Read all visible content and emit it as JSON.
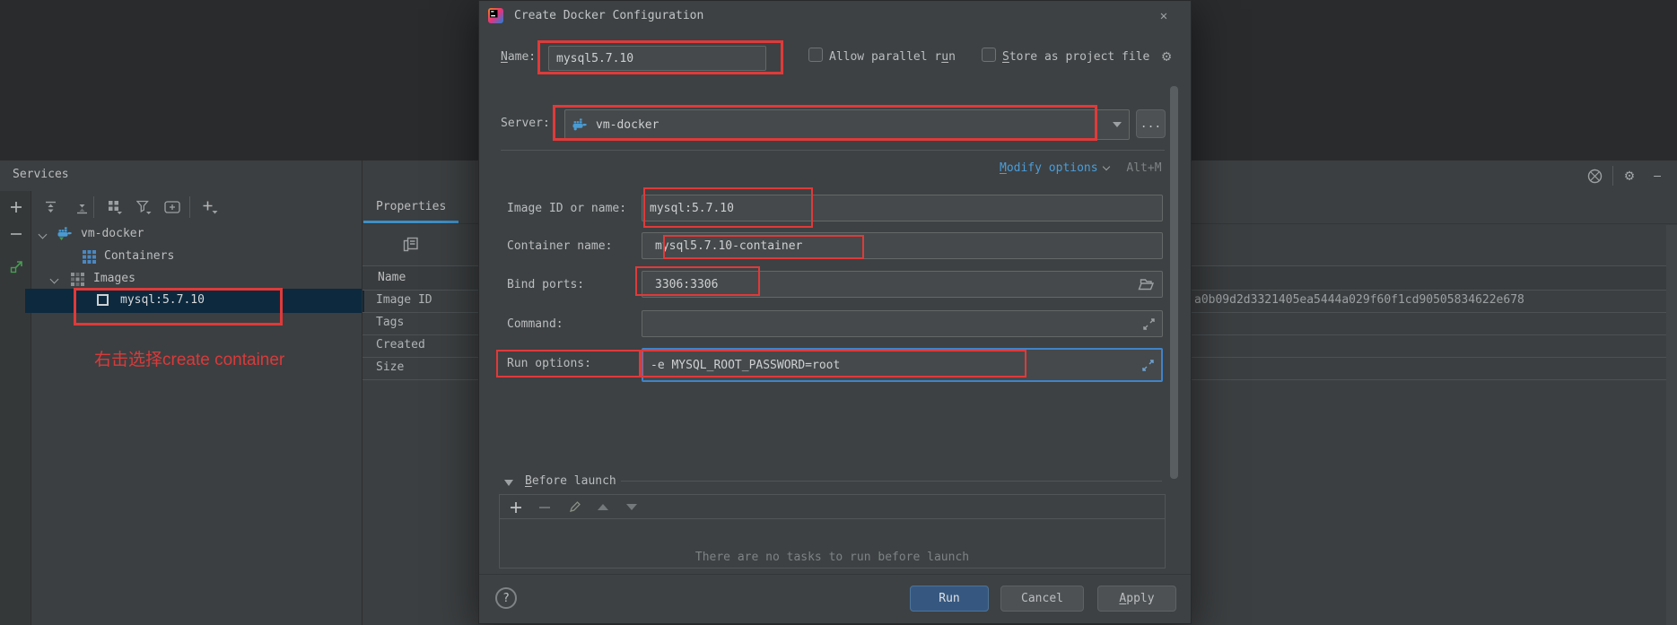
{
  "icons": {
    "gear": "⚙",
    "close": "✕",
    "help": "?",
    "minimize": "—"
  },
  "services": {
    "title": "Services",
    "tree": {
      "server": "vm-docker",
      "containers": "Containers",
      "images": "Images",
      "image": "mysql:5.7.10"
    },
    "annotation": "右击选择create container"
  },
  "properties": {
    "tab": "Properties",
    "column_header": "Name",
    "rows": [
      "Image ID",
      "Tags",
      "Created",
      "Size"
    ],
    "image_id_value": "a0b09d2d3321405ea5444a029f60f1cd90505834622e678"
  },
  "dialog": {
    "title": "Create Docker Configuration",
    "name_label": "Name:",
    "name_value": "mysql5.7.10",
    "allow_parallel_run_label": "Allow parallel run",
    "store_as_project_file_label": "Store as project file",
    "server_label": "Server:",
    "server_value": "vm-docker",
    "browse_label": "...",
    "modify_options_label": "Modify options",
    "modify_options_shortcut": "Alt+M",
    "image_label": "Image ID or name:",
    "image_value": "mysql:5.7.10",
    "container_label": "Container name:",
    "container_value": "mysql5.7.10-container",
    "bind_ports_label": "Bind ports:",
    "bind_ports_value": "3306:3306",
    "command_label": "Command:",
    "command_value": "",
    "run_options_label": "Run options:",
    "run_options_value": "-e MYSQL_ROOT_PASSWORD=root",
    "before_launch_label": "Before launch",
    "no_tasks_message": "There are no tasks to run before launch",
    "run_label": "Run",
    "cancel_label": "Cancel",
    "apply_label": "Apply"
  }
}
